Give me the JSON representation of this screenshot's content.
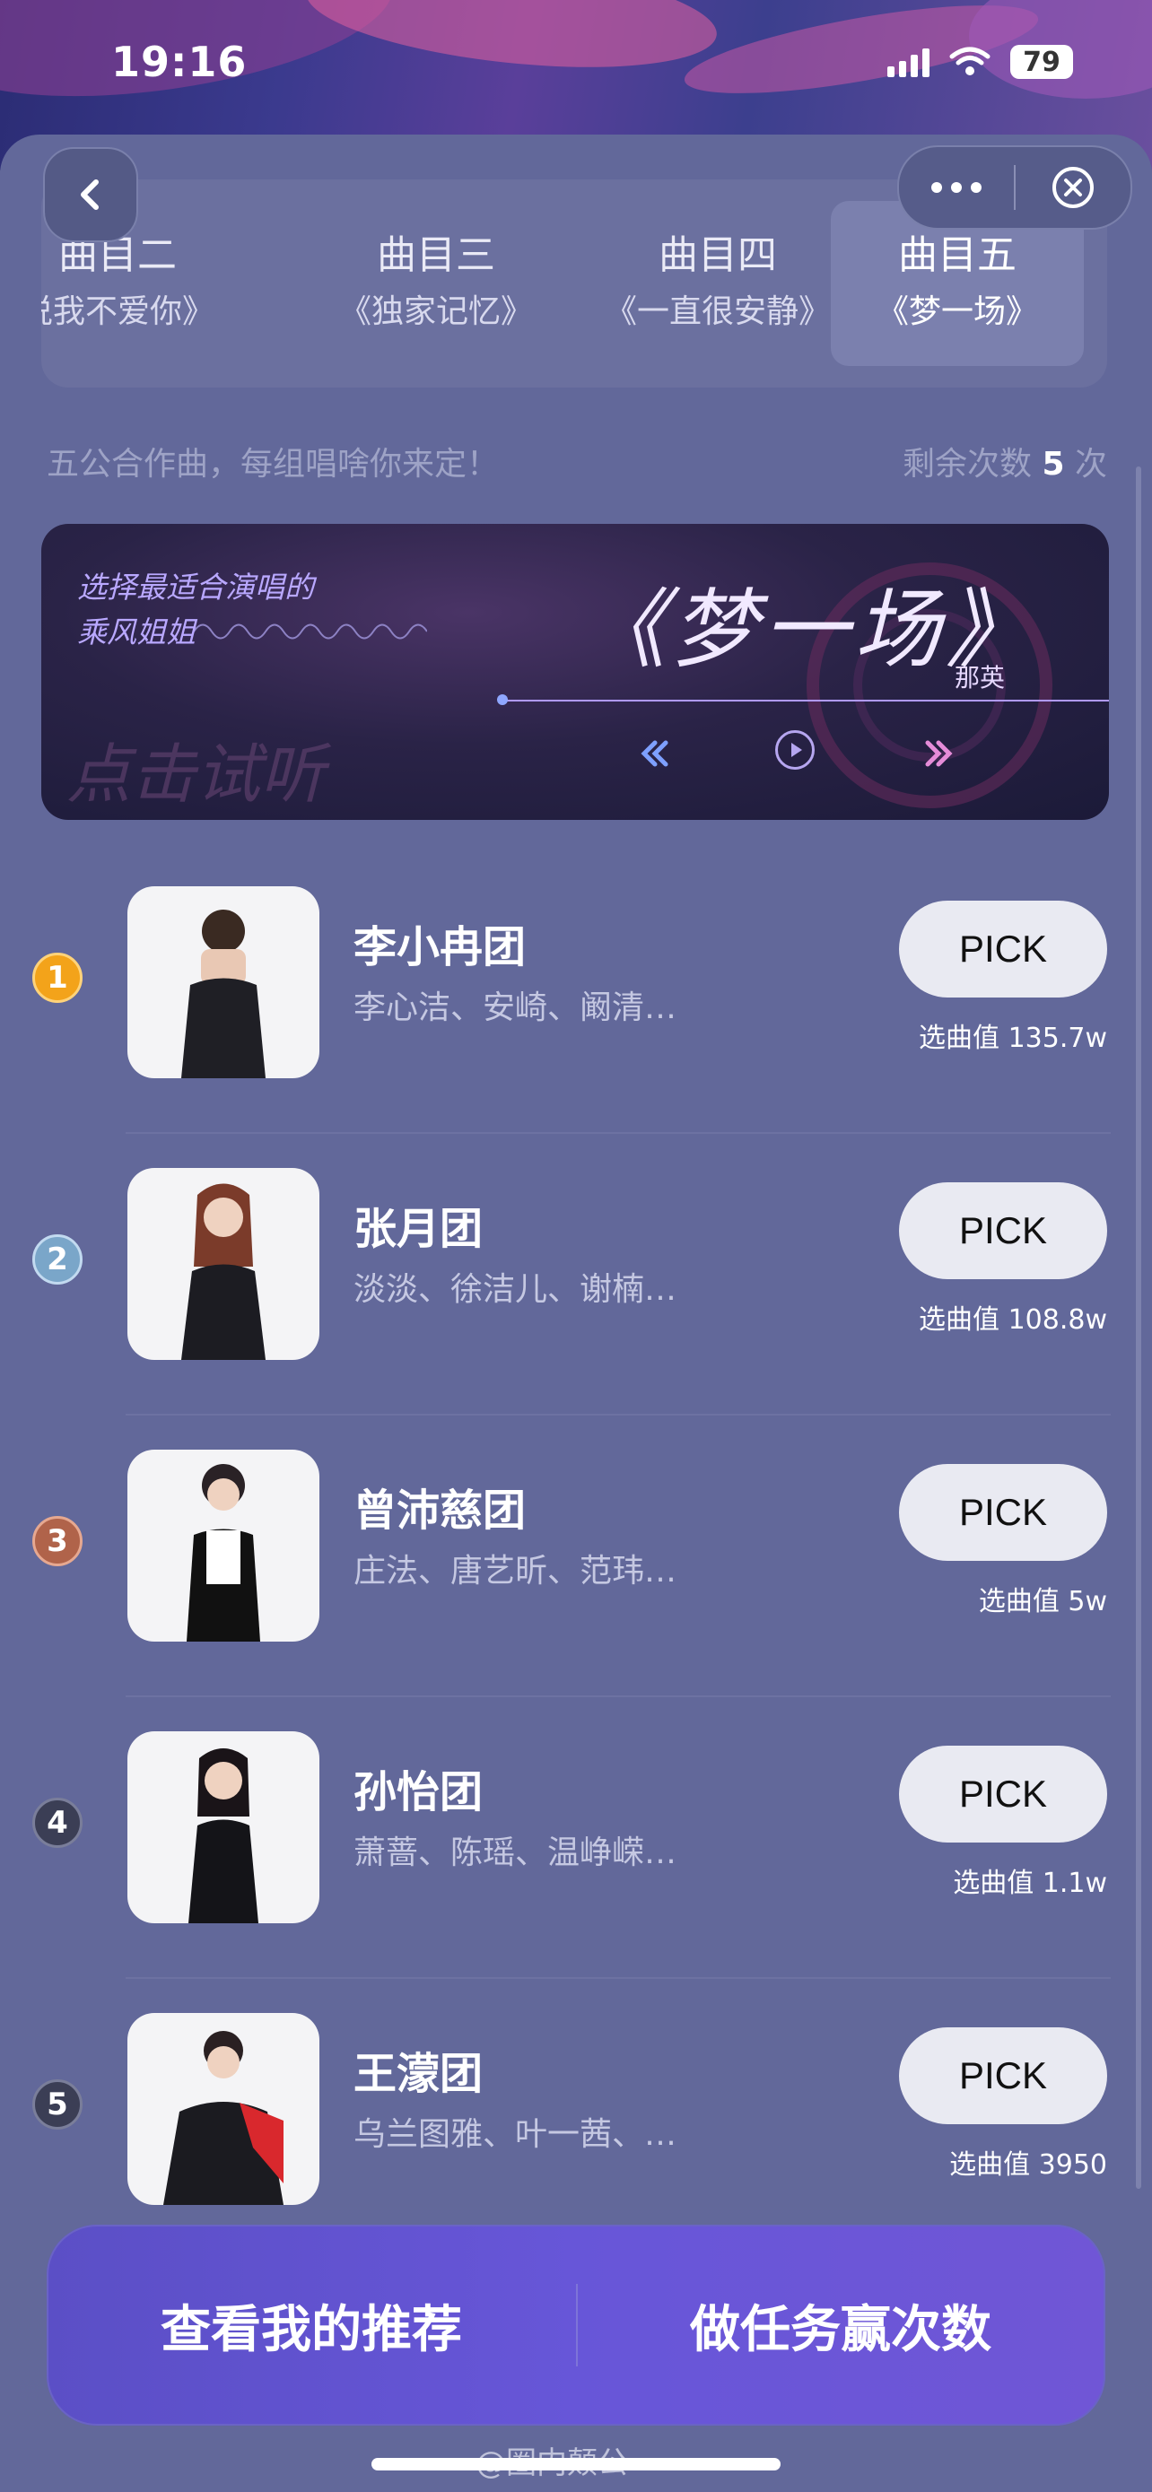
{
  "status_bar": {
    "time": "19:16",
    "battery": "79"
  },
  "nav": {
    "back_icon": "chevron-left-icon",
    "more_icon": "more-dots-icon",
    "close_icon": "close-circle-icon"
  },
  "tabs": [
    {
      "label": "曲目二",
      "song": "说我不爱你》",
      "active": false
    },
    {
      "label": "曲目三",
      "song": "《独家记忆》",
      "active": false
    },
    {
      "label": "曲目四",
      "song": "《一直很安静》",
      "active": false
    },
    {
      "label": "曲目五",
      "song": "《梦一场》",
      "active": true
    }
  ],
  "info": {
    "description": "五公合作曲，每组唱啥你来定！",
    "remaining_prefix": "剩余次数",
    "remaining_count": "5",
    "remaining_suffix": "次"
  },
  "player": {
    "tagline_line1": "选择最适合演唱的",
    "tagline_line2": "乘风姐姐",
    "song_title": "《梦一场》",
    "singer": "那英",
    "hint": "点击试听"
  },
  "groups": [
    {
      "rank": "1",
      "name": "李小冉团",
      "members": "李心洁、安崎、阚清…",
      "pick_label": "PICK",
      "score": "选曲值 135.7w",
      "rank_color": "#f3a31a"
    },
    {
      "rank": "2",
      "name": "张月团",
      "members": "淡淡、徐洁儿、谢楠…",
      "pick_label": "PICK",
      "score": "选曲值 108.8w",
      "rank_color": "#7aa6c9"
    },
    {
      "rank": "3",
      "name": "曾沛慈团",
      "members": "庄法、唐艺昕、范玮…",
      "pick_label": "PICK",
      "score": "选曲值 5w",
      "rank_color": "#b0634a"
    },
    {
      "rank": "4",
      "name": "孙怡团",
      "members": "萧蔷、陈瑶、温峥嵘…",
      "pick_label": "PICK",
      "score": "选曲值 1.1w",
      "rank_color": "#3b3e55"
    },
    {
      "rank": "5",
      "name": "王濛团",
      "members": "乌兰图雅、叶一茜、…",
      "pick_label": "PICK",
      "score": "选曲值 3950",
      "rank_color": "#3b3e55"
    }
  ],
  "bottom": {
    "left_label": "查看我的推荐",
    "right_label": "做任务赢次数"
  },
  "watermark": "@圈内颠公"
}
